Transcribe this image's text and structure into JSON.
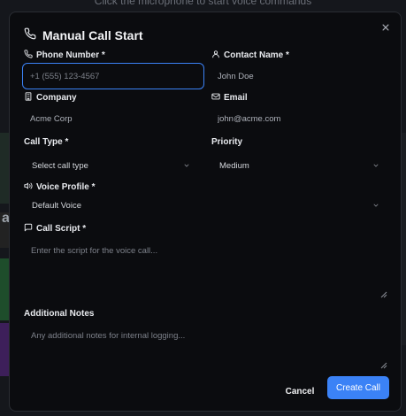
{
  "background": {
    "hint_text": "Click the microphone to start voice commands",
    "side_letter": "a"
  },
  "dialog": {
    "title": "Manual Call Start",
    "icons": {
      "title": "phone-icon",
      "close": "close-icon"
    }
  },
  "fields": {
    "phone": {
      "label": "Phone Number *",
      "placeholder": "+1 (555) 123-4567",
      "value": ""
    },
    "contact": {
      "label": "Contact Name *",
      "placeholder": "",
      "value": "John Doe"
    },
    "company": {
      "label": "Company",
      "placeholder": "",
      "value": "Acme Corp"
    },
    "email": {
      "label": "Email",
      "placeholder": "",
      "value": "john@acme.com"
    },
    "call_type": {
      "label": "Call Type *",
      "selected": "Select call type"
    },
    "priority": {
      "label": "Priority",
      "selected": "Medium"
    },
    "voice_profile": {
      "label": "Voice Profile *",
      "selected": "Default Voice"
    },
    "call_script": {
      "label": "Call Script *",
      "placeholder": "Enter the script for the voice call..."
    },
    "notes": {
      "label": "Additional Notes",
      "placeholder": "Any additional notes for internal logging..."
    }
  },
  "buttons": {
    "cancel": "Cancel",
    "create": "Create Call"
  },
  "colors": {
    "accent": "#3b82f6",
    "dialog_bg": "#0b0c0f"
  }
}
